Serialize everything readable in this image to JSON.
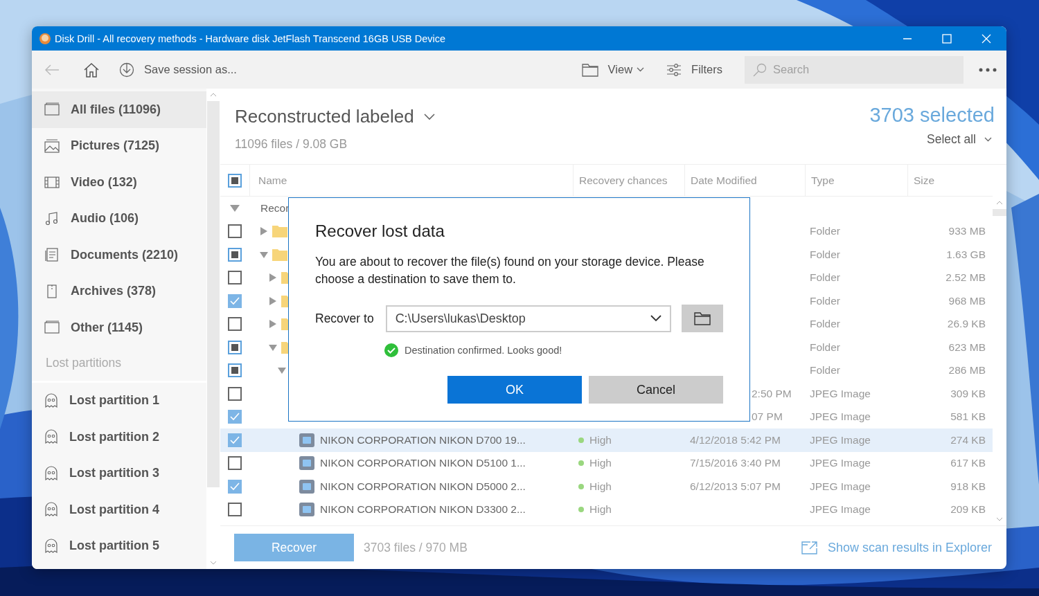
{
  "window": {
    "title": "Disk Drill - All recovery methods - Hardware disk JetFlash Transcend 16GB USB Device"
  },
  "toolbar": {
    "back_disabled": true,
    "save_label": "Save session as...",
    "view_label": "View",
    "filters_label": "Filters",
    "search": {
      "placeholder": "Search"
    }
  },
  "sidebar": {
    "items": [
      {
        "kind": "all",
        "label": "All files (11096)",
        "selected": true
      },
      {
        "kind": "pictures",
        "label": "Pictures (7125)",
        "selected": false
      },
      {
        "kind": "video",
        "label": "Video (132)",
        "selected": false
      },
      {
        "kind": "audio",
        "label": "Audio (106)",
        "selected": false
      },
      {
        "kind": "documents",
        "label": "Documents (2210)",
        "selected": false
      },
      {
        "kind": "archives",
        "label": "Archives (378)",
        "selected": false
      },
      {
        "kind": "other",
        "label": "Other (1145)",
        "selected": false
      }
    ],
    "section_label": "Lost partitions",
    "partitions": [
      {
        "label": "Lost partition 1"
      },
      {
        "label": "Lost partition 2"
      },
      {
        "label": "Lost partition 3"
      },
      {
        "label": "Lost partition 4"
      },
      {
        "label": "Lost partition 5"
      }
    ]
  },
  "header": {
    "title": "Reconstructed labeled",
    "summary": "11096 files / 9.08 GB",
    "selected_count": "3703 selected",
    "select_all": "Select all"
  },
  "table": {
    "header_checked": false,
    "header_indeterminate": true,
    "columns": [
      "Name",
      "Recovery chances",
      "Date Modified",
      "Type",
      "Size"
    ],
    "tree": [
      {
        "kind": "group",
        "name": "Recor",
        "expanded": true,
        "selected": false,
        "children": [
          {
            "kind": "folder",
            "checked": false,
            "indeterminate": false,
            "expanded": false,
            "selected": false,
            "type": "Folder",
            "size": "933 MB"
          },
          {
            "kind": "folder",
            "checked": false,
            "indeterminate": true,
            "expanded": true,
            "selected": false,
            "type": "Folder",
            "size": "1.63 GB",
            "children": [
              {
                "kind": "folder",
                "checked": false,
                "indeterminate": false,
                "expanded": false,
                "selected": false,
                "type": "Folder",
                "size": "2.52 MB"
              },
              {
                "kind": "folder",
                "checked": true,
                "indeterminate": false,
                "expanded": false,
                "selected": false,
                "type": "Folder",
                "size": "968 MB"
              },
              {
                "kind": "folder",
                "checked": false,
                "indeterminate": false,
                "expanded": false,
                "selected": false,
                "type": "Folder",
                "size": "26.9 KB"
              },
              {
                "kind": "folder",
                "checked": false,
                "indeterminate": true,
                "expanded": true,
                "selected": false,
                "type": "Folder",
                "size": "623 MB",
                "children": [
                  {
                    "checked": false,
                    "indeterminate": true,
                    "expanded": true,
                    "selected": false,
                    "type": "Folder",
                    "size": "286 MB",
                    "children": [
                      {
                        "checked": false,
                        "indeterminate": false,
                        "selected": false,
                        "date": "2:50 PM",
                        "type": "JPEG Image",
                        "size": "309 KB"
                      },
                      {
                        "checked": true,
                        "indeterminate": false,
                        "selected": false,
                        "date": "07 PM",
                        "type": "JPEG Image",
                        "size": "581 KB"
                      },
                      {
                        "kind": "file",
                        "checked": true,
                        "indeterminate": false,
                        "selected": true,
                        "name": "NIKON CORPORATION NIKON D700 19...",
                        "chance": "High",
                        "date": "4/12/2018 5:42 PM",
                        "type": "JPEG Image",
                        "size": "274 KB"
                      },
                      {
                        "kind": "file",
                        "checked": false,
                        "indeterminate": false,
                        "selected": false,
                        "name": "NIKON CORPORATION NIKON D5100 1...",
                        "chance": "High",
                        "date": "7/15/2016 3:40 PM",
                        "type": "JPEG Image",
                        "size": "617 KB"
                      },
                      {
                        "kind": "file",
                        "checked": true,
                        "indeterminate": false,
                        "selected": false,
                        "name": "NIKON CORPORATION NIKON D5000 2...",
                        "chance": "High",
                        "date": "6/12/2013 5:07 PM",
                        "type": "JPEG Image",
                        "size": "918 KB"
                      },
                      {
                        "kind": "file",
                        "checked": false,
                        "indeterminate": false,
                        "selected": false,
                        "name": "NIKON CORPORATION NIKON D3300 2...",
                        "chance": "High",
                        "type": "JPEG Image",
                        "size": "209 KB"
                      }
                    ]
                  }
                ]
              }
            ]
          }
        ]
      }
    ]
  },
  "footer": {
    "recover": "Recover",
    "summary": "3703 files / 970 MB",
    "explorer_link": "Show scan results in Explorer"
  },
  "dialog": {
    "title": "Recover lost data",
    "message": "You are about to recover the file(s) found on your storage device. Please choose a destination to save them to.",
    "recover_to_label": "Recover to",
    "destination": "C:\\Users\\lukas\\Desktop",
    "confirmed": true,
    "confirmation": "Destination confirmed. Looks good!",
    "ok": "OK",
    "cancel": "Cancel"
  }
}
